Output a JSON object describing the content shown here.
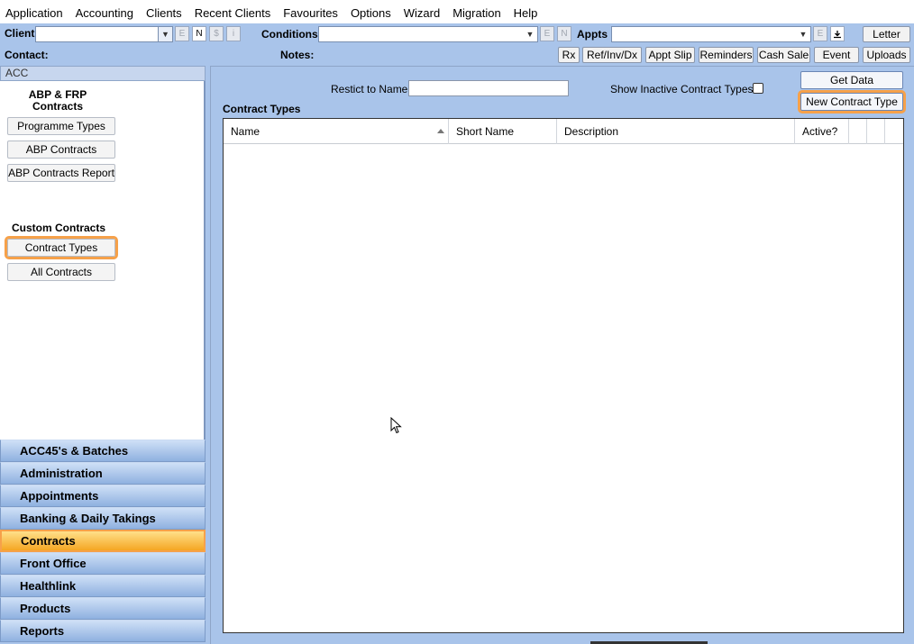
{
  "menu": [
    "Application",
    "Accounting",
    "Clients",
    "Recent Clients",
    "Favourites",
    "Options",
    "Wizard",
    "Migration",
    "Help"
  ],
  "toolbar": {
    "client_label": "Client",
    "client_sq": [
      "E",
      "N",
      "$",
      "i"
    ],
    "conditions_label": "Conditions",
    "conditions_sq": [
      "E",
      "N"
    ],
    "appts_label": "Appts",
    "appts_sq": [
      "E"
    ],
    "letter": "Letter",
    "contact_label": "Contact:",
    "notes_label": "Notes:",
    "buttons": [
      "Rx",
      "Ref/Inv/Dx",
      "Appt Slip",
      "Reminders",
      "Cash Sale",
      "Event",
      "Uploads"
    ]
  },
  "left": {
    "header": "ACC",
    "section1": "ABP & FRP Contracts",
    "section1_buttons": [
      "Programme Types",
      "ABP Contracts",
      "ABP Contracts Report"
    ],
    "section2": "Custom Contracts",
    "section2_buttons": [
      "Contract Types",
      "All Contracts"
    ]
  },
  "nav": [
    "ACC45's & Batches",
    "Administration",
    "Appointments",
    "Banking & Daily Takings",
    "Contracts",
    "Front Office",
    "Healthlink",
    "Products",
    "Reports"
  ],
  "main": {
    "restrict_label": "Restict to Name",
    "show_inactive_label": "Show Inactive Contract Types?",
    "get_data": "Get Data",
    "new_contract_type": "New Contract Type",
    "grid_title": "Contract Types",
    "columns": [
      "Name",
      "Short Name",
      "Description",
      "Active?"
    ]
  },
  "icons": {
    "dropdown": "chevron-down-icon",
    "download": "download-icon",
    "sort": "sort-ascending-icon",
    "cursor": "mouse-pointer-icon"
  },
  "colors": {
    "highlight": "#f6a14a",
    "background": "#a9c4ea"
  }
}
